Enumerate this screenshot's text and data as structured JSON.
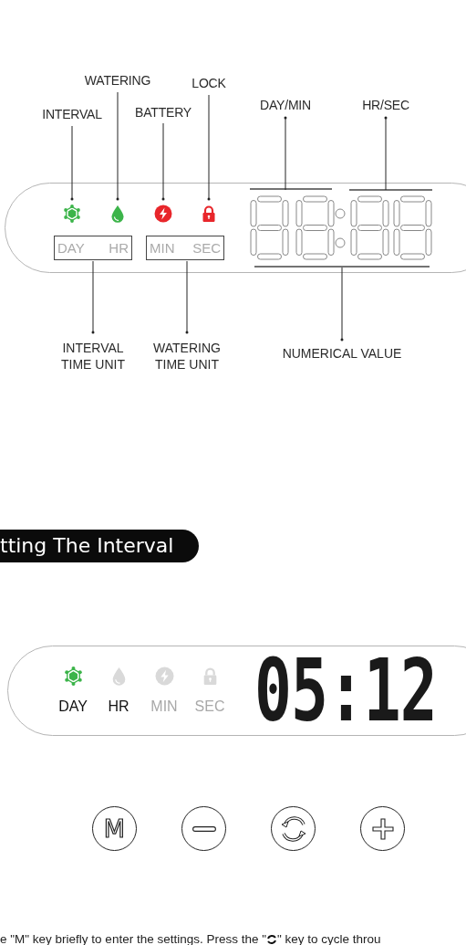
{
  "legend_diagram": {
    "indicators": [
      {
        "kind": "interval",
        "label": "INTERVAL",
        "color": "#3cb44a"
      },
      {
        "kind": "watering",
        "label": "WATERING",
        "color": "#3cb44a"
      },
      {
        "kind": "battery",
        "label": "BATTERY",
        "color": "#e8262b"
      },
      {
        "kind": "lock",
        "label": "LOCK",
        "color": "#e8262b"
      }
    ],
    "unit_groups": [
      {
        "units": [
          "DAY",
          "HR"
        ],
        "caption": "INTERVAL TIME UNIT"
      },
      {
        "units": [
          "MIN",
          "SEC"
        ],
        "caption": "WATERING TIME UNIT"
      }
    ],
    "digit_labels": [
      "DAY/MIN",
      "HR/SEC"
    ],
    "value_label": "NUMERICAL VALUE"
  },
  "section_title": "tting The Interval",
  "display": {
    "indicators": [
      {
        "kind": "interval",
        "on": true
      },
      {
        "kind": "watering",
        "on": false
      },
      {
        "kind": "battery",
        "on": false
      },
      {
        "kind": "lock",
        "on": false
      }
    ],
    "units": [
      {
        "label": "DAY",
        "on": true
      },
      {
        "label": "HR",
        "on": true
      },
      {
        "label": "MIN",
        "on": false
      },
      {
        "label": "SEC",
        "on": false
      }
    ],
    "reading": "05:12"
  },
  "keys": [
    {
      "kind": "letter",
      "label": "M"
    },
    {
      "kind": "minus"
    },
    {
      "kind": "cycle"
    },
    {
      "kind": "plus"
    }
  ],
  "instruction": {
    "before": "e \"M\" key briefly to enter the settings. Press the \"",
    "after": "\" key to cycle throu"
  }
}
